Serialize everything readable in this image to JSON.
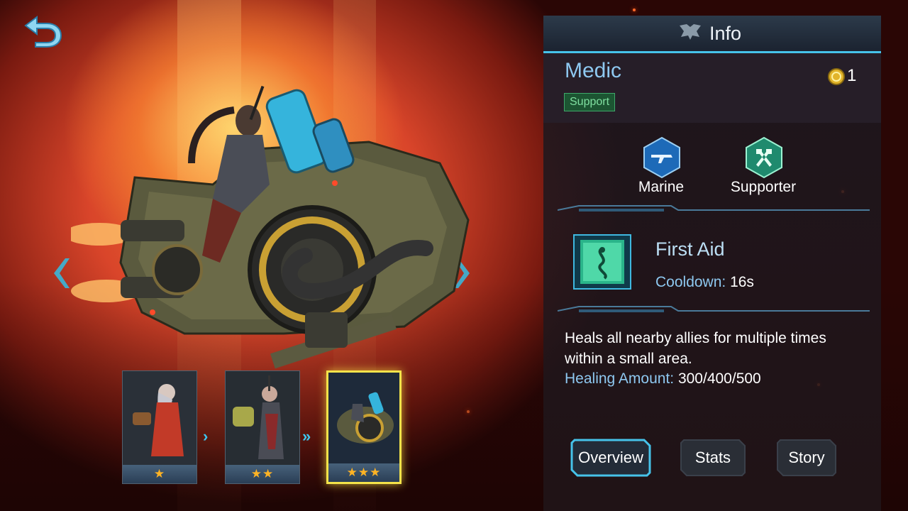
{
  "nav": {
    "back_icon": "back-arrow-icon",
    "prev_icon": "chevron-left-icon",
    "next_icon": "chevron-right-icon"
  },
  "evolutions": [
    {
      "stars": "★",
      "selected": false
    },
    {
      "stars": "★★",
      "selected": false
    },
    {
      "stars": "★★★",
      "selected": true
    }
  ],
  "panel": {
    "title": "Info",
    "hero_name": "Medic",
    "role_badge": "Support",
    "coin_count": "1",
    "classes": [
      {
        "label": "Marine",
        "icon": "rifle-icon",
        "color": "#1d6ab8"
      },
      {
        "label": "Supporter",
        "icon": "crossed-hammers-icon",
        "color": "#1f8a6e"
      }
    ],
    "skill": {
      "name": "First Aid",
      "cooldown_label": "Cooldown:",
      "cooldown_value": "16s",
      "description": "Heals all nearby allies for multiple times within a small area.",
      "healing_label": "Healing Amount:",
      "healing_value": "300/400/500"
    },
    "tabs": [
      {
        "label": "Overview",
        "active": true
      },
      {
        "label": "Stats",
        "active": false
      },
      {
        "label": "Story",
        "active": false
      }
    ]
  },
  "colors": {
    "accent": "#46c3ea",
    "badge_green": "#1c5532",
    "gold": "#f4e34a"
  }
}
